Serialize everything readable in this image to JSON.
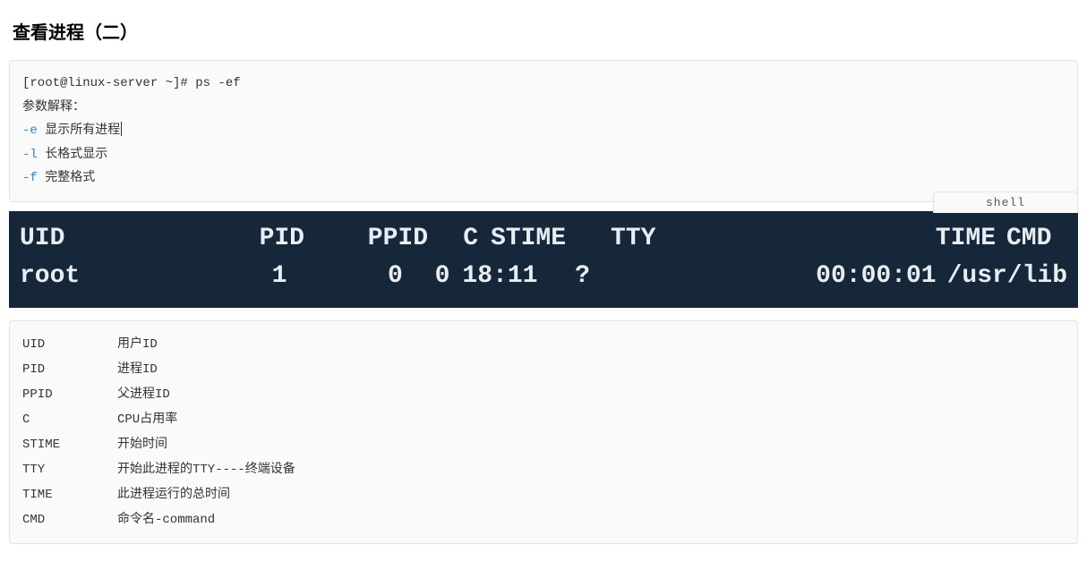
{
  "title": "查看进程（二）",
  "code1": {
    "prompt": "[root@linux-server ~]# ps -ef",
    "explain_label": "参数解释：",
    "params": [
      {
        "flag": "-e",
        "text": "显示所有进程",
        "cursor": true
      },
      {
        "flag": "-l",
        "text": "长格式显示",
        "cursor": false
      },
      {
        "flag": "-f",
        "text": "完整格式",
        "cursor": false
      }
    ]
  },
  "lang_tag": "shell",
  "terminal": {
    "headers": {
      "uid": "UID",
      "pid": "PID",
      "ppid": "PPID",
      "c": "C",
      "stime": "STIME",
      "tty": "TTY",
      "time": "TIME",
      "cmd": "CMD"
    },
    "row": {
      "uid": "root",
      "pid": "1",
      "ppid": "0",
      "c": "0",
      "stime": "18:11",
      "tty": "?",
      "time": "00:00:01",
      "cmd": "/usr/lib"
    }
  },
  "descriptions": [
    {
      "key": "UID",
      "val": "用户ID"
    },
    {
      "key": "PID",
      "val": "进程ID"
    },
    {
      "key": "PPID",
      "val": "父进程ID"
    },
    {
      "key": "C",
      "val": "CPU占用率"
    },
    {
      "key": "STIME",
      "val": "开始时间"
    },
    {
      "key": "TTY",
      "val": "开始此进程的TTY----终端设备"
    },
    {
      "key": "TIME",
      "val": "此进程运行的总时间"
    },
    {
      "key": "CMD",
      "val": "命令名-command"
    }
  ]
}
